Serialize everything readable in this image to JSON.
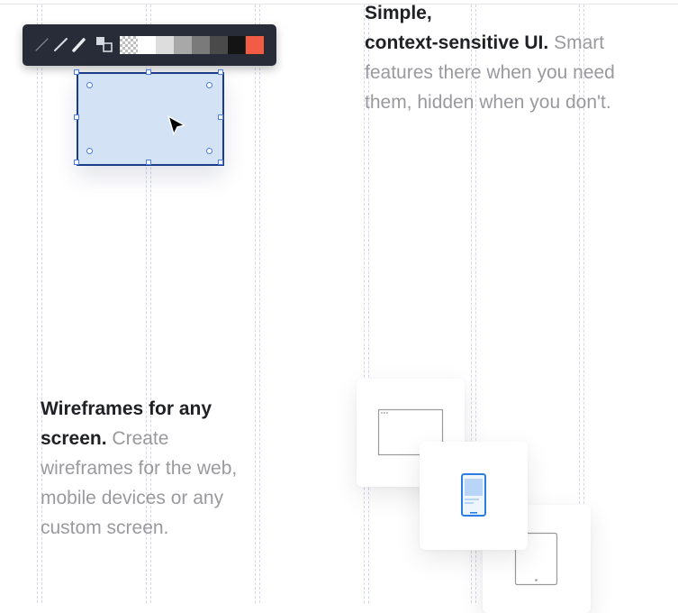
{
  "toolbar": {
    "tools": [
      {
        "icon": "thin-line-icon"
      },
      {
        "icon": "medium-line-icon"
      },
      {
        "icon": "thick-line-icon"
      },
      {
        "icon": "fill-stroke-swap-icon"
      }
    ],
    "swatches": [
      "transparent",
      "#ffffff",
      "#dddddd",
      "#a8a8a8",
      "#7a7a7a",
      "#4a4a4a",
      "#141414",
      "#f25c44"
    ]
  },
  "features": {
    "context": {
      "title_line1": "Simple,",
      "title_line2": "context-sensitive UI.",
      "description": "Smart features there when you need them, hidden when you don't."
    },
    "wireframes": {
      "title": "Wireframes for any screen.",
      "description": "Create wireframes for the web, mobile devices or any custom screen."
    }
  },
  "devices": [
    {
      "icon": "browser-window-icon"
    },
    {
      "icon": "mobile-phone-icon"
    },
    {
      "icon": "tablet-icon"
    }
  ],
  "colors": {
    "selection": "#1a3b8a",
    "shape_fill": "#d4e2f5",
    "handle": "#4a7de0",
    "accent_blue": "#2b7de3",
    "toolbar_bg": "#272c38"
  }
}
